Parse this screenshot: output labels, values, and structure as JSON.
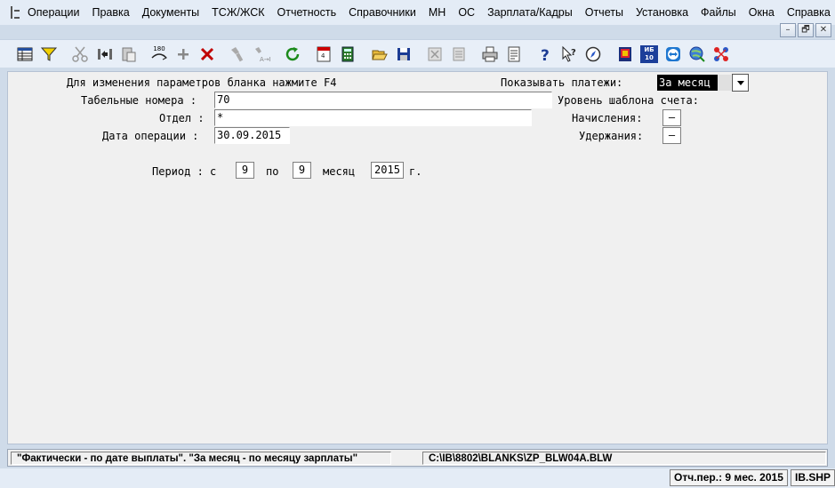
{
  "menu": [
    "Операции",
    "Правка",
    "Документы",
    "ТСЖ/ЖСК",
    "Отчетность",
    "Справочники",
    "МН",
    "ОС",
    "Зарплата/Кадры",
    "Отчеты",
    "Установка",
    "Файлы",
    "Окна",
    "Справка"
  ],
  "window_buttons": {
    "minimize": "–",
    "restore": "🗗",
    "close": "✕"
  },
  "toolbar": {
    "icons": [
      "table-view-icon",
      "filter-icon",
      "cut-icon",
      "exchange-icon",
      "paste-icon",
      "rotate-180-icon",
      "plus-icon",
      "delete-icon",
      "flashlight-icon",
      "find-replace-icon",
      "refresh-icon",
      "calendar-icon",
      "calculator-icon",
      "open-folder-icon",
      "save-icon",
      "disabled-close-icon",
      "disabled-doc-icon",
      "printer-icon",
      "preview-icon",
      "help-icon",
      "context-help-icon",
      "compass-icon",
      "book-icon",
      "ib10-icon",
      "teamviewer-icon",
      "globe-icon",
      "network-icon"
    ],
    "rotate_label": "180",
    "ib10_label_top": "ИБ",
    "ib10_label_bottom": "10"
  },
  "form": {
    "hint": "Для изменения параметров бланка нажмите F4",
    "show_payments_label": "Показывать платежи:",
    "show_payments_value": "За месяц",
    "tab_numbers_label": "Табельные номера :",
    "tab_numbers_value": "70",
    "department_label": "Отдел :",
    "department_value": "*",
    "operation_date_label": "Дата операции :",
    "operation_date_value": "30.09.2015",
    "template_level_label": "Уровень шаблона счета:",
    "accruals_label": "Начисления:",
    "accruals_value": "–",
    "deductions_label": "Удержания:",
    "deductions_value": "–",
    "period_label": "Период : с",
    "period_from": "9",
    "period_to_label": "по",
    "period_to": "9",
    "month_label": "месяц",
    "year": "2015",
    "year_suffix": "г."
  },
  "status": {
    "hint": "\"Фактически - по дате выплаты\". \"За месяц - по месяцу зарплаты\"",
    "path": "C:\\IB\\8802\\BLANKS\\ZP_BLW04A.BLW",
    "period": "Отч.пер.: 9 мес. 2015",
    "module": "IB.SHP"
  }
}
